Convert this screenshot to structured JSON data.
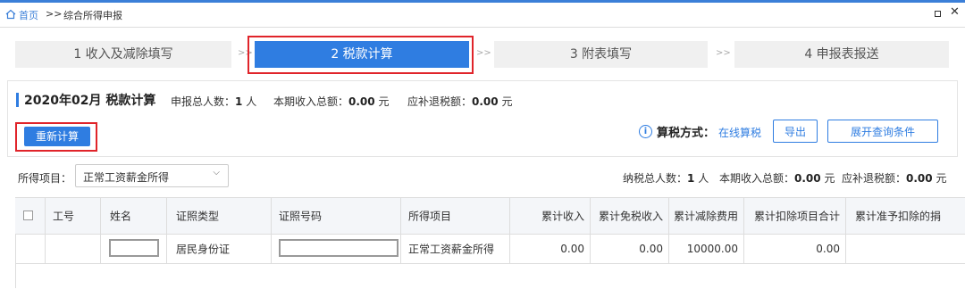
{
  "breadcrumb": {
    "home": "首页",
    "separator": ">>",
    "current": "综合所得申报"
  },
  "window": {
    "restore_icon": "restore-icon",
    "close_icon": "close-icon",
    "close_glyph": "✕"
  },
  "steps": [
    {
      "label": "1 收入及减除填写"
    },
    {
      "label": "2 税款计算"
    },
    {
      "label": "3 附表填写"
    },
    {
      "label": "4 申报表报送"
    }
  ],
  "step_arrow": ">>",
  "summary": {
    "title": "2020年02月 税款计算",
    "people_label": "申报总人数：",
    "people_value": "1",
    "people_unit": "人",
    "income_label": "本期收入总额：",
    "income_value": "0.00",
    "income_unit": "元",
    "tax_label": "应补退税额：",
    "tax_value": "0.00",
    "tax_unit": "元"
  },
  "actions": {
    "recalc": "重新计算",
    "info_glyph": "i",
    "calc_label": "算税方式：",
    "calc_mode": "在线算税",
    "export": "导出",
    "expand": "展开查询条件"
  },
  "filter": {
    "label": "所得项目：",
    "value": "正常工资薪金所得"
  },
  "totals": {
    "people_label": "纳税总人数：",
    "people_value": "1",
    "people_unit": "人",
    "income_label": "本期收入总额：",
    "income_value": "0.00",
    "income_unit": "元",
    "tax_label": "应补退税额：",
    "tax_value": "0.00",
    "tax_unit": "元"
  },
  "table": {
    "headers": [
      "工号",
      "姓名",
      "证照类型",
      "证照号码",
      "所得项目",
      "累计收入",
      "累计免税收入",
      "累计减除费用",
      "累计扣除项目合计",
      "累计准予扣除的捐"
    ],
    "rows": [
      {
        "id": "",
        "name": "",
        "id_type": "居民身份证",
        "id_number": "",
        "income_item": "正常工资薪金所得",
        "cum_income": "0.00",
        "cum_exempt": "0.00",
        "cum_deduction": "10000.00",
        "cum_items_total": "0.00",
        "cum_donation": ""
      }
    ]
  },
  "colors": {
    "accent": "#2f7de1",
    "highlight": "#e0242a"
  }
}
